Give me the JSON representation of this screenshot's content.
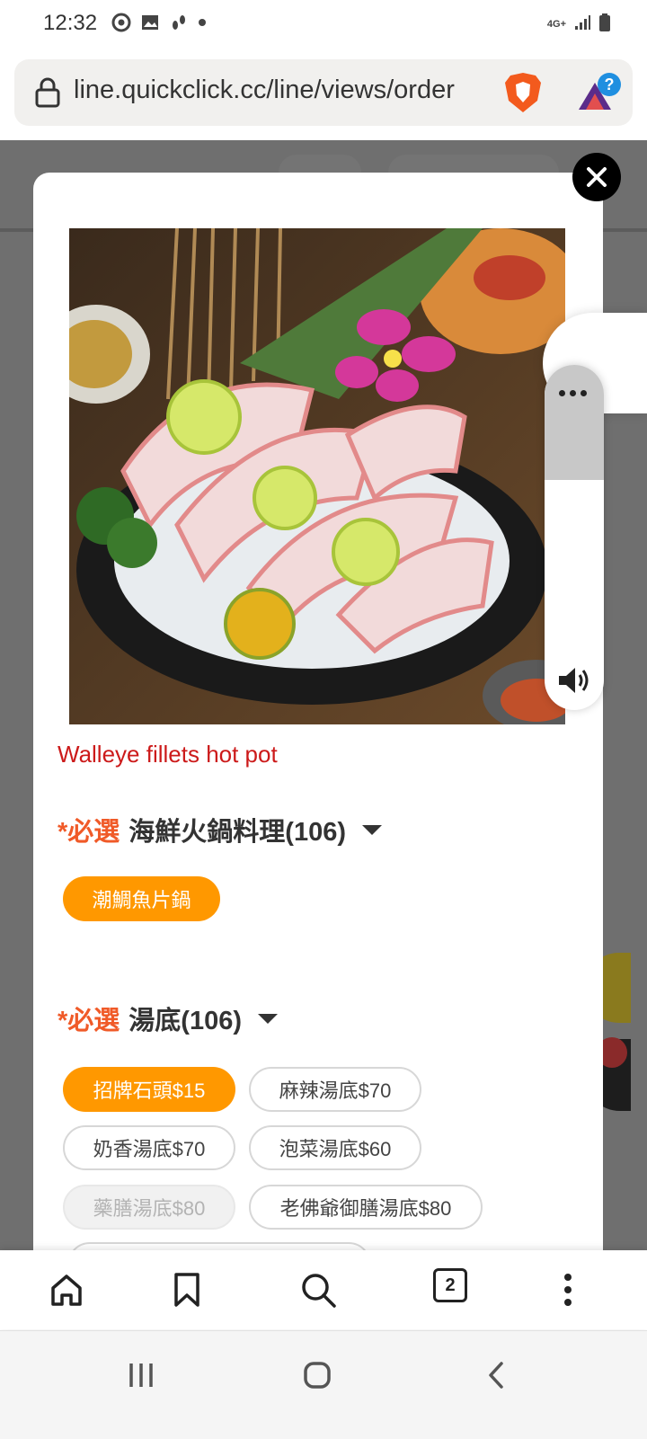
{
  "status_bar": {
    "time": "12:32",
    "left_icons": [
      "chrome-icon",
      "gallery-icon",
      "footprints-icon",
      "dot-icon"
    ],
    "network_label": "4G+",
    "right_icons": [
      "signal-icon",
      "battery-icon"
    ]
  },
  "browser": {
    "url": "line.quickclick.cc/line/views/order",
    "bottom_nav": {
      "items": [
        "home-icon",
        "bookmark-icon",
        "search-icon",
        "tabs-icon",
        "more-icon"
      ],
      "tab_count": "2"
    }
  },
  "modal": {
    "item_name": "Walleye fillets hot pot",
    "option_groups": [
      {
        "required_marker": "*必選",
        "title": "海鮮火鍋料理(106)",
        "options": [
          {
            "label": "潮鯛魚片鍋",
            "state": "selected"
          }
        ]
      },
      {
        "required_marker": "*必選",
        "title": "湯底(106)",
        "options": [
          {
            "label": "招牌石頭$15",
            "state": "selected"
          },
          {
            "label": "麻辣湯底$70",
            "state": "unselected"
          },
          {
            "label": "奶香湯底$70",
            "state": "unselected"
          },
          {
            "label": "泡菜湯底$60",
            "state": "unselected"
          },
          {
            "label": "藥膳湯底$80",
            "state": "disabled"
          },
          {
            "label": "老佛爺御膳湯底$80",
            "state": "unselected"
          }
        ]
      }
    ]
  },
  "colors": {
    "accent": "#ff9800",
    "required": "#f05a28",
    "item_name": "#cc1a1a"
  }
}
